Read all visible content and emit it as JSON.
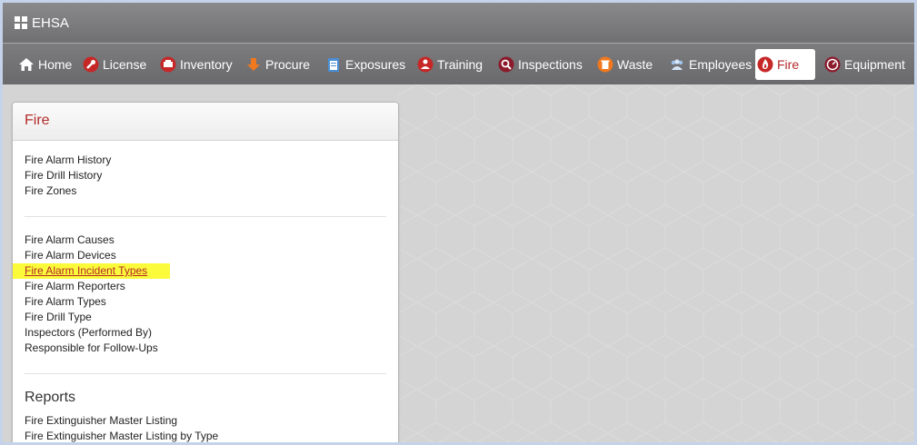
{
  "app": {
    "title": "EHSA"
  },
  "nav": [
    {
      "label": "Home",
      "icon": "home-icon",
      "active": false
    },
    {
      "label": "License",
      "icon": "wrench-icon",
      "active": false
    },
    {
      "label": "Inventory",
      "icon": "inventory-icon",
      "active": false
    },
    {
      "label": "Procure",
      "icon": "down-arrow-icon",
      "active": false
    },
    {
      "label": "Exposures",
      "icon": "clipboard-icon",
      "active": false
    },
    {
      "label": "Training",
      "icon": "training-icon",
      "active": false
    },
    {
      "label": "Inspections",
      "icon": "magnifier-icon",
      "active": false
    },
    {
      "label": "Waste",
      "icon": "trash-icon",
      "active": false
    },
    {
      "label": "Employees",
      "icon": "people-icon",
      "active": false
    },
    {
      "label": "Fire",
      "icon": "flame-icon",
      "active": true
    },
    {
      "label": "Equipment",
      "icon": "gauge-icon",
      "active": false
    }
  ],
  "panel": {
    "title": "Fire",
    "group1": [
      "Fire Alarm History",
      "Fire Drill History",
      "Fire Zones"
    ],
    "group2": [
      "Fire Alarm Causes",
      "Fire Alarm Devices",
      "Fire Alarm Incident Types",
      "Fire Alarm Reporters",
      "Fire Alarm Types",
      "Fire Drill Type",
      "Inspectors (Performed By)",
      "Responsible for Follow-Ups"
    ],
    "highlighted": "Fire Alarm Incident Types",
    "reports_title": "Reports",
    "reports": [
      "Fire Extinguisher Master Listing",
      "Fire Extinguisher Master Listing by Type"
    ]
  },
  "colors": {
    "accent": "#b5282a",
    "highlight": "#fbfb3b",
    "bar": "#757577"
  }
}
